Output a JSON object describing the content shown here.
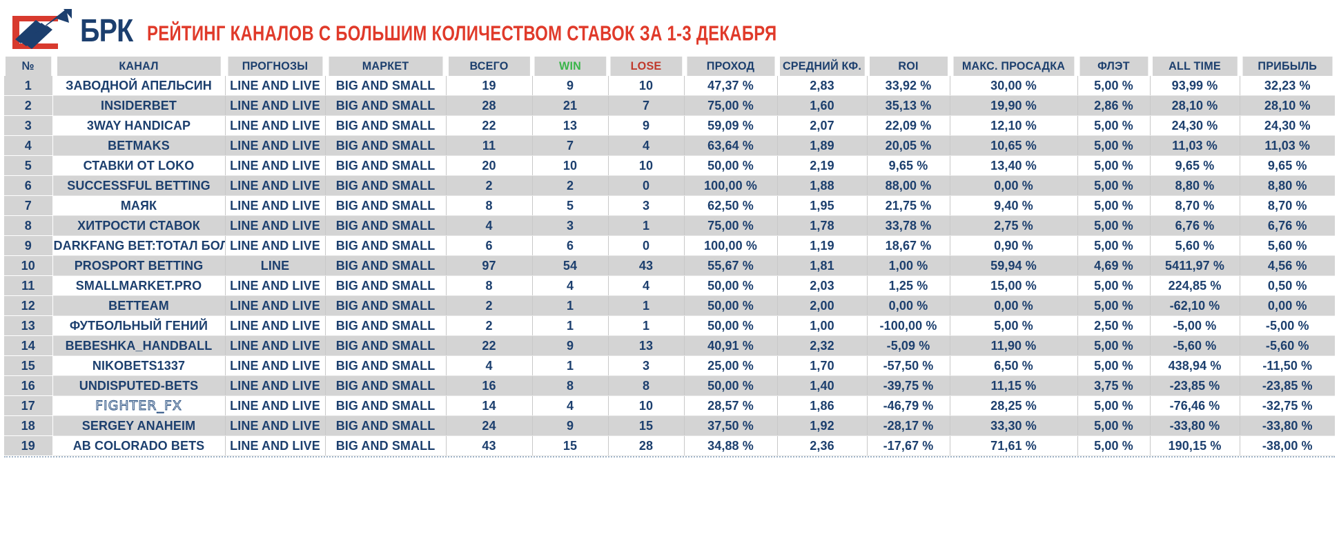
{
  "brand": {
    "logo_icon": "brk-arrow-logo",
    "name": "БРК"
  },
  "header": {
    "title": "РЕЙТИНГ КАНАЛОВ С БОЛЬШИМ КОЛИЧЕСТВОМ СТАВОК ЗА 1-3 ДЕКАБРЯ",
    "title_color": "#e03a2a"
  },
  "colors": {
    "brand_blue": "#1c3f6e",
    "brand_red": "#e03a2a",
    "win_green": "#3ab54a",
    "lose_red": "#c0392b",
    "header_bg": "#d4d4d4",
    "row_alt_bg": "#d4d4d4"
  },
  "table": {
    "columns": [
      "№",
      "КАНАЛ",
      "ПРОГНОЗЫ",
      "МАРКЕТ",
      "ВСЕГО",
      "WIN",
      "LOSE",
      "ПРОХОД",
      "СРЕДНИЙ КФ.",
      "ROI",
      "МАКС. ПРОСАДКА",
      "ФЛЭТ",
      "ALL TIME",
      "ПРИБЫЛЬ"
    ],
    "rows": [
      {
        "num": "1",
        "channel": "ЗАВОДНОЙ АПЕЛЬСИН",
        "forecasts": "LINE AND LIVE",
        "market": "BIG AND SMALL",
        "total": "19",
        "win": "9",
        "lose": "10",
        "pass": "47,37 %",
        "avg_odds": "2,83",
        "roi": "33,92 %",
        "max_drawdown": "30,00 %",
        "flat": "5,00 %",
        "all_time": "93,99 %",
        "profit": "32,23 %"
      },
      {
        "num": "2",
        "channel": "INSIDERBET",
        "forecasts": "LINE AND LIVE",
        "market": "BIG AND SMALL",
        "total": "28",
        "win": "21",
        "lose": "7",
        "pass": "75,00 %",
        "avg_odds": "1,60",
        "roi": "35,13 %",
        "max_drawdown": "19,90 %",
        "flat": "2,86 %",
        "all_time": "28,10 %",
        "profit": "28,10 %"
      },
      {
        "num": "3",
        "channel": "3WAY HANDICAP",
        "forecasts": "LINE AND LIVE",
        "market": "BIG AND SMALL",
        "total": "22",
        "win": "13",
        "lose": "9",
        "pass": "59,09 %",
        "avg_odds": "2,07",
        "roi": "22,09 %",
        "max_drawdown": "12,10 %",
        "flat": "5,00 %",
        "all_time": "24,30 %",
        "profit": "24,30 %"
      },
      {
        "num": "4",
        "channel": "BETMAKS",
        "forecasts": "LINE AND LIVE",
        "market": "BIG AND SMALL",
        "total": "11",
        "win": "7",
        "lose": "4",
        "pass": "63,64 %",
        "avg_odds": "1,89",
        "roi": "20,05 %",
        "max_drawdown": "10,65 %",
        "flat": "5,00 %",
        "all_time": "11,03 %",
        "profit": "11,03 %"
      },
      {
        "num": "5",
        "channel": "СТАВКИ ОТ LOKO",
        "forecasts": "LINE AND LIVE",
        "market": "BIG AND SMALL",
        "total": "20",
        "win": "10",
        "lose": "10",
        "pass": "50,00 %",
        "avg_odds": "2,19",
        "roi": "9,65 %",
        "max_drawdown": "13,40 %",
        "flat": "5,00 %",
        "all_time": "9,65 %",
        "profit": "9,65 %"
      },
      {
        "num": "6",
        "channel": "SUCCESSFUL BETTING",
        "forecasts": "LINE AND LIVE",
        "market": "BIG AND SMALL",
        "total": "2",
        "win": "2",
        "lose": "0",
        "pass": "100,00 %",
        "avg_odds": "1,88",
        "roi": "88,00 %",
        "max_drawdown": "0,00 %",
        "flat": "5,00 %",
        "all_time": "8,80 %",
        "profit": "8,80 %"
      },
      {
        "num": "7",
        "channel": "МАЯК",
        "forecasts": "LINE AND LIVE",
        "market": "BIG AND SMALL",
        "total": "8",
        "win": "5",
        "lose": "3",
        "pass": "62,50 %",
        "avg_odds": "1,95",
        "roi": "21,75 %",
        "max_drawdown": "9,40 %",
        "flat": "5,00 %",
        "all_time": "8,70 %",
        "profit": "8,70 %"
      },
      {
        "num": "8",
        "channel": "ХИТРОСТИ СТАВОК",
        "forecasts": "LINE AND LIVE",
        "market": "BIG AND SMALL",
        "total": "4",
        "win": "3",
        "lose": "1",
        "pass": "75,00 %",
        "avg_odds": "1,78",
        "roi": "33,78 %",
        "max_drawdown": "2,75 %",
        "flat": "5,00 %",
        "all_time": "6,76 %",
        "profit": "6,76 %"
      },
      {
        "num": "9",
        "channel": "DARKFANG BET:ТОТАЛ БОЛЬШЕ",
        "forecasts": "LINE AND LIVE",
        "market": "BIG AND SMALL",
        "total": "6",
        "win": "6",
        "lose": "0",
        "pass": "100,00 %",
        "avg_odds": "1,19",
        "roi": "18,67 %",
        "max_drawdown": "0,90 %",
        "flat": "5,00 %",
        "all_time": "5,60 %",
        "profit": "5,60 %"
      },
      {
        "num": "10",
        "channel": "PROSPORT BETTING",
        "forecasts": "LINE",
        "market": "BIG AND SMALL",
        "total": "97",
        "win": "54",
        "lose": "43",
        "pass": "55,67 %",
        "avg_odds": "1,81",
        "roi": "1,00 %",
        "max_drawdown": "59,94 %",
        "flat": "4,69 %",
        "all_time": "5411,97 %",
        "profit": "4,56 %"
      },
      {
        "num": "11",
        "channel": "SMALLMARKET.PRO",
        "forecasts": "LINE AND LIVE",
        "market": "BIG AND SMALL",
        "total": "8",
        "win": "4",
        "lose": "4",
        "pass": "50,00 %",
        "avg_odds": "2,03",
        "roi": "1,25 %",
        "max_drawdown": "15,00 %",
        "flat": "5,00 %",
        "all_time": "224,85 %",
        "profit": "0,50 %"
      },
      {
        "num": "12",
        "channel": "BETTEAM",
        "forecasts": "LINE AND LIVE",
        "market": "BIG AND SMALL",
        "total": "2",
        "win": "1",
        "lose": "1",
        "pass": "50,00 %",
        "avg_odds": "2,00",
        "roi": "0,00 %",
        "max_drawdown": "0,00 %",
        "flat": "5,00 %",
        "all_time": "-62,10 %",
        "profit": "0,00 %"
      },
      {
        "num": "13",
        "channel": "ФУТБОЛЬНЫЙ ГЕНИЙ",
        "forecasts": "LINE AND LIVE",
        "market": "BIG AND SMALL",
        "total": "2",
        "win": "1",
        "lose": "1",
        "pass": "50,00 %",
        "avg_odds": "1,00",
        "roi": "-100,00 %",
        "max_drawdown": "5,00 %",
        "flat": "2,50 %",
        "all_time": "-5,00 %",
        "profit": "-5,00 %"
      },
      {
        "num": "14",
        "channel": "BEBESHKA_HANDBALL",
        "forecasts": "LINE AND LIVE",
        "market": "BIG AND SMALL",
        "total": "22",
        "win": "9",
        "lose": "13",
        "pass": "40,91 %",
        "avg_odds": "2,32",
        "roi": "-5,09 %",
        "max_drawdown": "11,90 %",
        "flat": "5,00 %",
        "all_time": "-5,60 %",
        "profit": "-5,60 %"
      },
      {
        "num": "15",
        "channel": "NIKOBETS1337",
        "forecasts": "LINE AND LIVE",
        "market": "BIG AND SMALL",
        "total": "4",
        "win": "1",
        "lose": "3",
        "pass": "25,00 %",
        "avg_odds": "1,70",
        "roi": "-57,50 %",
        "max_drawdown": "6,50 %",
        "flat": "5,00 %",
        "all_time": "438,94 %",
        "profit": "-11,50 %"
      },
      {
        "num": "16",
        "channel": "UNDISPUTED-BETS",
        "forecasts": "LINE AND LIVE",
        "market": "BIG AND SMALL",
        "total": "16",
        "win": "8",
        "lose": "8",
        "pass": "50,00 %",
        "avg_odds": "1,40",
        "roi": "-39,75 %",
        "max_drawdown": "11,15 %",
        "flat": "3,75 %",
        "all_time": "-23,85 %",
        "profit": "-23,85 %"
      },
      {
        "num": "17",
        "channel": "FIGHTER_FX",
        "style": "outline",
        "forecasts": "LINE AND LIVE",
        "market": "BIG AND SMALL",
        "total": "14",
        "win": "4",
        "lose": "10",
        "pass": "28,57 %",
        "avg_odds": "1,86",
        "roi": "-46,79 %",
        "max_drawdown": "28,25 %",
        "flat": "5,00 %",
        "all_time": "-76,46 %",
        "profit": "-32,75 %"
      },
      {
        "num": "18",
        "channel": "SERGEY ANAHEIM",
        "forecasts": "LINE AND LIVE",
        "market": "BIG AND SMALL",
        "total": "24",
        "win": "9",
        "lose": "15",
        "pass": "37,50 %",
        "avg_odds": "1,92",
        "roi": "-28,17 %",
        "max_drawdown": "33,30 %",
        "flat": "5,00 %",
        "all_time": "-33,80 %",
        "profit": "-33,80 %"
      },
      {
        "num": "19",
        "channel": "AB COLORADO BETS",
        "forecasts": "LINE AND LIVE",
        "market": "BIG AND SMALL",
        "total": "43",
        "win": "15",
        "lose": "28",
        "pass": "34,88 %",
        "avg_odds": "2,36",
        "roi": "-17,67 %",
        "max_drawdown": "71,61 %",
        "flat": "5,00 %",
        "all_time": "190,15 %",
        "profit": "-38,00 %"
      }
    ]
  }
}
